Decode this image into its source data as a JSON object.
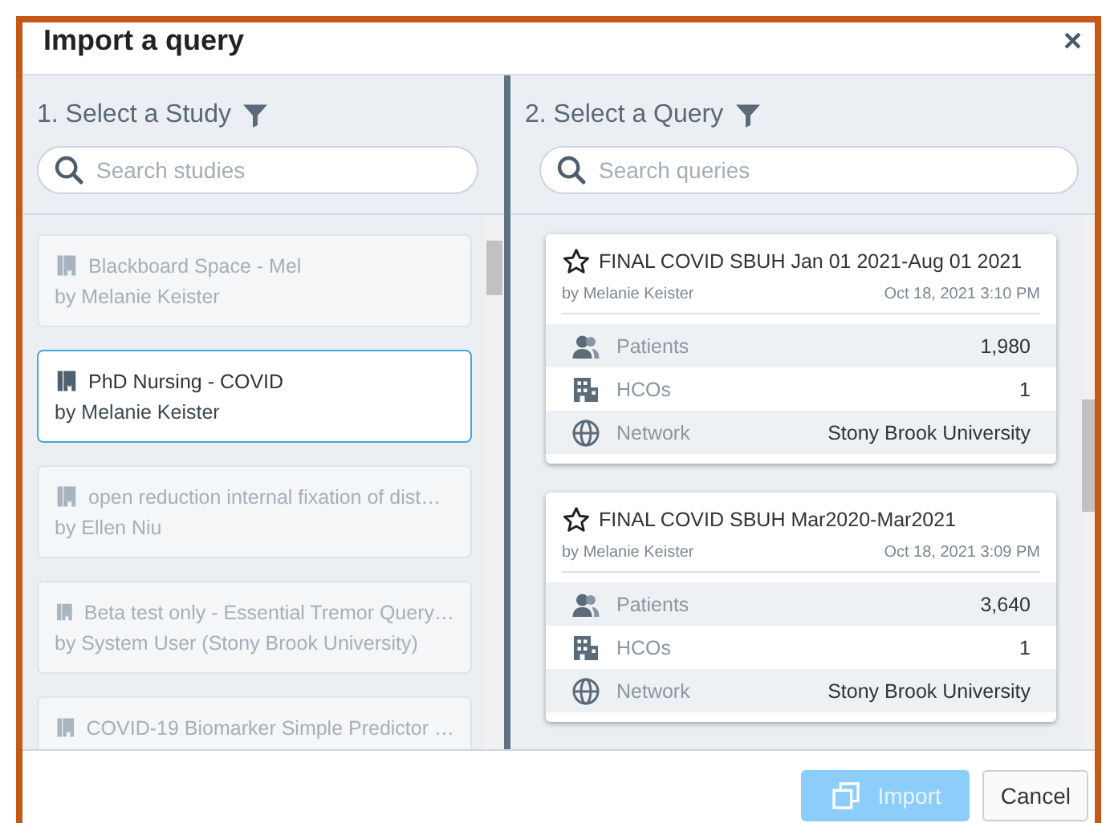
{
  "dialog": {
    "title": "Import a query",
    "close": "×"
  },
  "study_pane": {
    "heading": "1. Select a Study",
    "search": {
      "placeholder": "Search studies"
    },
    "studies": [
      {
        "name": "Blackboard Space - Mel",
        "author": "by Melanie Keister",
        "selected": false
      },
      {
        "name": "PhD Nursing - COVID",
        "author": "by Melanie Keister",
        "selected": true
      },
      {
        "name": "open reduction internal fixation of dist…",
        "author": "by Ellen Niu",
        "selected": false
      },
      {
        "name": "Beta test only - Essential Tremor Query…",
        "author": "by System User (Stony Brook University)",
        "selected": false
      },
      {
        "name": "COVID-19 Biomarker Simple Predictor …",
        "selected": false
      }
    ]
  },
  "query_pane": {
    "heading": "2. Select a Query",
    "search": {
      "placeholder": "Search queries"
    },
    "queries": [
      {
        "title": "FINAL COVID SBUH Jan 01 2021-Aug 01 2021",
        "author": "by Melanie Keister",
        "date": "Oct 18, 2021 3:10 PM",
        "starred": false,
        "stats": [
          {
            "kind": "patients",
            "label": "Patients",
            "value": "1,980"
          },
          {
            "kind": "hcos",
            "label": "HCOs",
            "value": "1"
          },
          {
            "kind": "network",
            "label": "Network",
            "value": "Stony Brook University"
          }
        ]
      },
      {
        "title": "FINAL COVID SBUH Mar2020-Mar2021",
        "author": "by Melanie Keister",
        "date": "Oct 18, 2021 3:09 PM",
        "starred": false,
        "stats": [
          {
            "kind": "patients",
            "label": "Patients",
            "value": "3,640"
          },
          {
            "kind": "hcos",
            "label": "HCOs",
            "value": "1"
          },
          {
            "kind": "network",
            "label": "Network",
            "value": "Stony Brook University"
          }
        ]
      }
    ]
  },
  "footer": {
    "import_button": {
      "label": "Import",
      "disabled": true
    },
    "cancel_button": {
      "label": "Cancel"
    }
  }
}
